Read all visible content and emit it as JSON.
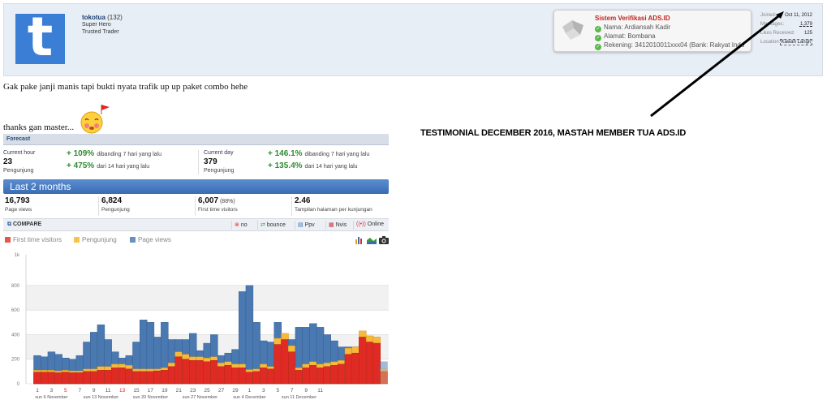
{
  "post": {
    "user": {
      "avatar_letter": "t",
      "name": "tokotua",
      "post_count": "(132)",
      "rank": "Super Hero",
      "status": "Trusted Trader"
    },
    "verification": {
      "title": "Sistem Verifikasi ADS.ID",
      "rows": [
        "Nama: Ardiansah Kadir",
        "Alamat: Bombana",
        "Rekening: 3412010011xxx04 (Bank: Rakyat Indo"
      ]
    },
    "stats": [
      {
        "label": "Joined:",
        "value": "Oct 11, 2012"
      },
      {
        "label": "Messages:",
        "value": "1,379"
      },
      {
        "label": "Likes Received:",
        "value": "125"
      },
      {
        "label": "Location:",
        "value": "Kawah Langit"
      }
    ],
    "line1": "Gak pake janji manis tapi bukti nyata trafik up up paket combo hehe",
    "line2": "thanks gan master..."
  },
  "annotation": "TESTIMONIAL DECEMBER 2016, MASTAH MEMBER TUA ADS.ID",
  "analytics": {
    "forecast_title": "Forecast",
    "current_hour": {
      "label": "Current hour",
      "value": "23",
      "sub": "Pengunjung"
    },
    "current_day": {
      "label": "Current day",
      "value": "379",
      "sub": "Pengunjung"
    },
    "hour_changes": [
      {
        "pct": "+ 109%",
        "text": "dibanding 7 hari yang lalu"
      },
      {
        "pct": "+ 475%",
        "text": "dari 14 hari yang lalu"
      }
    ],
    "day_changes": [
      {
        "pct": "+ 146.1%",
        "text": "dibanding 7 hari yang lalu"
      },
      {
        "pct": "+ 135.4%",
        "text": "dari 14 hari yang lalu"
      }
    ],
    "period_title": "Last 2 months",
    "summary": [
      {
        "value": "16,793",
        "extra": "",
        "label": "Page views"
      },
      {
        "value": "6,824",
        "extra": "",
        "label": "Pengunjung"
      },
      {
        "value": "6,007",
        "extra": " (88%)",
        "label": "First time visitors"
      },
      {
        "value": "2.46",
        "extra": "",
        "label": "Tampilan halaman per kunjungan"
      }
    ],
    "compare_label": "COMPARE",
    "compare_buttons": [
      "no",
      "bounce",
      "Ppv",
      "Nvis",
      "Online"
    ],
    "legend": [
      "First time visitors",
      "Pengunjung",
      "Page views"
    ],
    "colors": {
      "first": "#e02b24",
      "pengunjung": "#f6b93b",
      "pageviews": "#4a78b0",
      "accent": "#3a6cb5"
    }
  },
  "chart_data": {
    "type": "bar",
    "series": [
      {
        "name": "First time visitors",
        "values": [
          95,
          95,
          95,
          90,
          95,
          90,
          90,
          100,
          100,
          110,
          110,
          130,
          130,
          120,
          100,
          100,
          100,
          105,
          110,
          140,
          220,
          200,
          190,
          190,
          180,
          190,
          140,
          150,
          130,
          130,
          95,
          100,
          130,
          120,
          320,
          360,
          260,
          110,
          130,
          150,
          130,
          140,
          150,
          160,
          240,
          250,
          380,
          340,
          330,
          100
        ]
      },
      {
        "name": "Pengunjung",
        "values": [
          110,
          110,
          110,
          105,
          110,
          105,
          105,
          120,
          120,
          140,
          140,
          160,
          160,
          150,
          120,
          120,
          120,
          120,
          130,
          170,
          260,
          240,
          220,
          220,
          210,
          220,
          170,
          180,
          160,
          160,
          115,
          120,
          160,
          140,
          370,
          410,
          310,
          130,
          160,
          180,
          160,
          170,
          180,
          190,
          290,
          300,
          430,
          390,
          380,
          120
        ]
      },
      {
        "name": "Page views",
        "values": [
          230,
          220,
          260,
          240,
          210,
          200,
          230,
          340,
          420,
          480,
          360,
          260,
          210,
          230,
          340,
          520,
          500,
          380,
          500,
          360,
          360,
          360,
          410,
          270,
          330,
          400,
          230,
          250,
          280,
          750,
          800,
          500,
          350,
          340,
          500,
          340,
          360,
          460,
          460,
          490,
          460,
          400,
          350,
          300,
          300,
          300,
          310,
          310,
          300,
          180
        ]
      }
    ],
    "x_ticks": [
      "1",
      "3",
      "5",
      "7",
      "9",
      "11",
      "13",
      "15",
      "17",
      "19",
      "21",
      "23",
      "25",
      "27",
      "29",
      "1",
      "3",
      "5",
      "7",
      "9",
      "11"
    ],
    "red_ticks": [
      "5",
      "13",
      "19",
      "27",
      "3",
      "11"
    ],
    "week_labels": [
      "sun 6 November",
      "sun 13 November",
      "sun 20 November",
      "sun 27 November",
      "sun 4 December",
      "sun 11 December"
    ],
    "y_ticks": [
      0,
      200,
      400,
      600,
      800
    ],
    "y_top_label": "1k",
    "ylim": [
      0,
      1050
    ]
  }
}
